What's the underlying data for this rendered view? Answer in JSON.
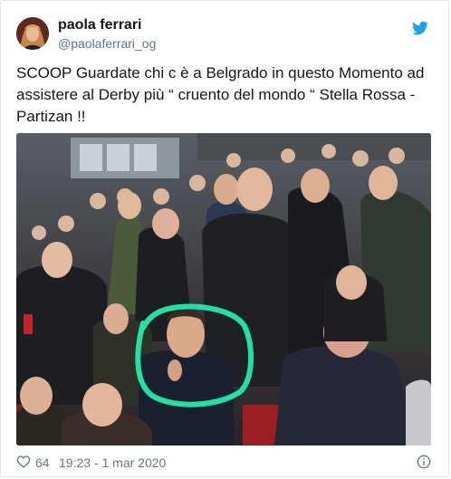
{
  "tweet": {
    "author_name": "paola ferrari",
    "author_handle": "@paolaferrari_og",
    "text": "SCOOP Guardate chi c è a  Belgrado in questo Momento ad assistere al Derby più “ cruento del mondo “ Stella Rossa - Partizan !!",
    "likes": "64",
    "timestamp": "19:23 - 1 mar 2020"
  },
  "media": {
    "description": "Photo of spectators in a stadium stand; one man circled in green",
    "highlight_color": "#22e0a0"
  },
  "icons": {
    "brand": "twitter-bird-icon",
    "like": "heart-icon",
    "info": "info-icon"
  },
  "colors": {
    "brand": "#1da1f2",
    "text": "#14171a",
    "secondary": "#657786"
  }
}
